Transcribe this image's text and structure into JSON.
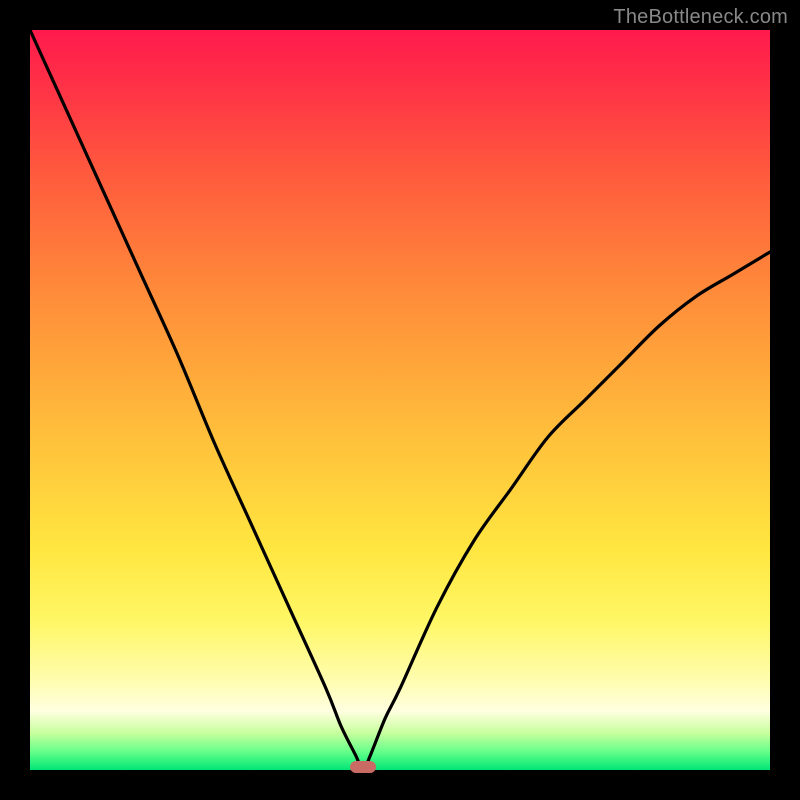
{
  "watermark": "TheBottleneck.com",
  "colors": {
    "frame": "#000000",
    "curve": "#000000",
    "marker": "#c96a64",
    "gradient_top": "#ff1a4d",
    "gradient_bottom": "#00e676"
  },
  "chart_data": {
    "type": "line",
    "title": "",
    "xlabel": "",
    "ylabel": "",
    "xlim": [
      0,
      100
    ],
    "ylim": [
      0,
      100
    ],
    "x": [
      0,
      5,
      10,
      15,
      20,
      25,
      30,
      35,
      40,
      42,
      44,
      45,
      46,
      48,
      50,
      55,
      60,
      65,
      70,
      75,
      80,
      85,
      90,
      95,
      100
    ],
    "values": [
      100,
      89,
      78,
      67,
      56,
      44,
      33,
      22,
      11,
      6,
      2,
      0,
      2,
      7,
      11,
      22,
      31,
      38,
      45,
      50,
      55,
      60,
      64,
      67,
      70
    ],
    "marker": {
      "x": 45,
      "y": 0
    },
    "notes": "Absolute V-shaped bottleneck curve; minimum (green zone) near x≈45. Values are percent-of-plot estimates read from pixel positions; no numeric axis labels are visible."
  }
}
